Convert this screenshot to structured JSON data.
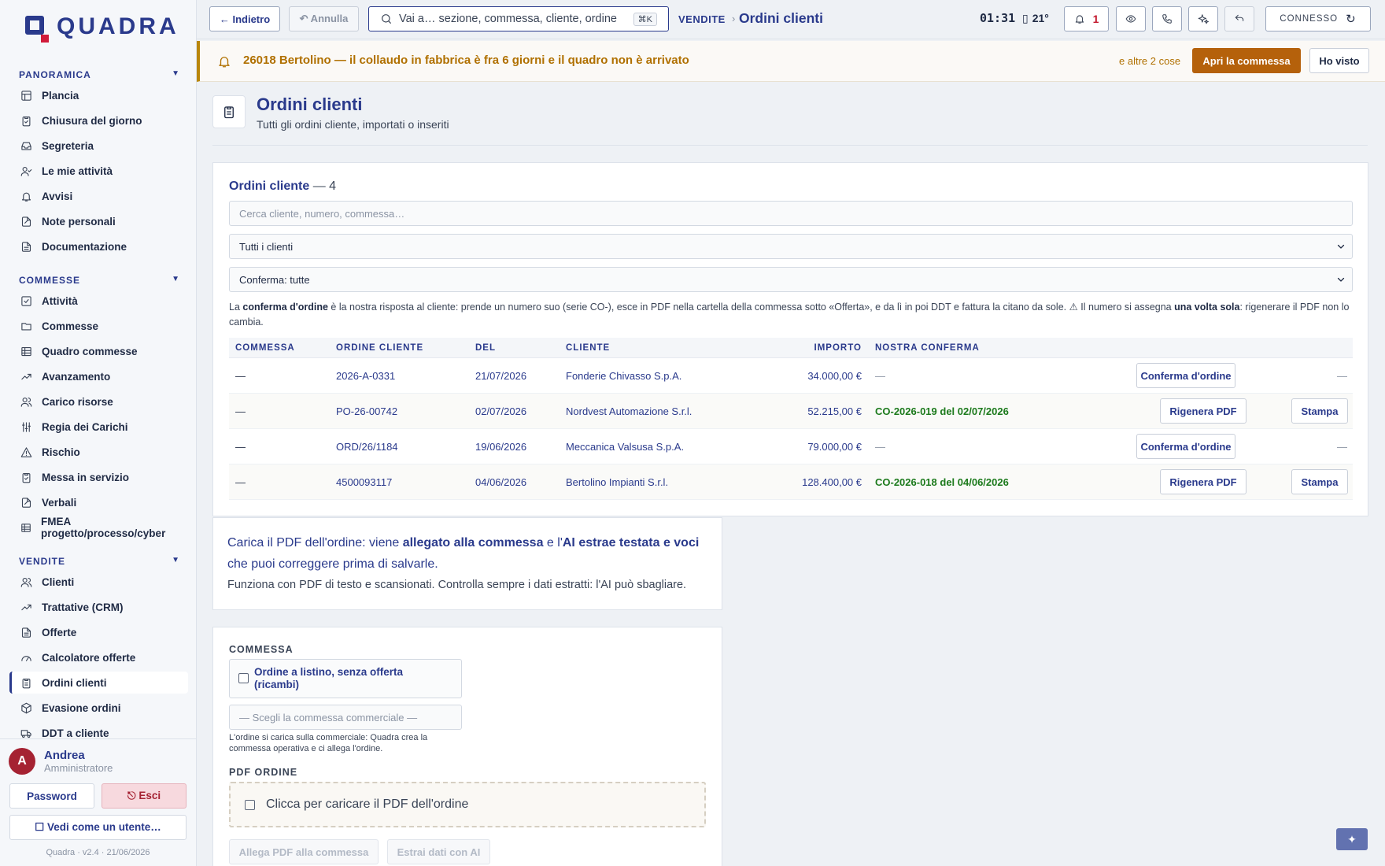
{
  "app": {
    "name": "QUADRA",
    "version": "Quadra · v2.4 · 21/06/2026"
  },
  "sidebar": {
    "sections": [
      {
        "title": "PANORAMICA",
        "items": [
          "Plancia",
          "Chiusura del giorno",
          "Segreteria",
          "Le mie attività",
          "Avvisi",
          "Note personali",
          "Documentazione"
        ]
      },
      {
        "title": "COMMESSE",
        "items": [
          "Attività",
          "Commesse",
          "Quadro commesse",
          "Avanzamento",
          "Carico risorse",
          "Regia dei Carichi",
          "Rischio",
          "Messa in servizio",
          "Verbali",
          "FMEA progetto/processo/cyber"
        ]
      },
      {
        "title": "VENDITE",
        "items": [
          "Clienti",
          "Trattative (CRM)",
          "Offerte",
          "Calcolatore offerte",
          "Ordini clienti",
          "Evasione ordini",
          "DDT a cliente"
        ]
      }
    ],
    "active": "Ordini clienti",
    "user": {
      "initial": "A",
      "name": "Andrea",
      "role": "Amministratore"
    },
    "password_label": "Password",
    "logout_label": "⎋ Esci",
    "impersonate_label": "☐ Vedi come un utente…"
  },
  "topbar": {
    "back_label": "← Indietro",
    "undo_label": "↶ Annulla",
    "search_placeholder": "Vai a… sezione, commessa, cliente, ordine",
    "search_shortcut": "⌘K",
    "breadcrumb_section": "VENDITE",
    "breadcrumb_sep": "›",
    "breadcrumb_page": "Ordini clienti",
    "clock": "01:31",
    "temperature": "21°",
    "notifications": "1",
    "status": "CONNESSO"
  },
  "alert": {
    "text": "26018 Bertolino — il collaudo in fabbrica è fra 6 giorni e il quadro non è arrivato",
    "more": "e altre 2 cose",
    "open_label": "Apri la commessa",
    "seen_label": "Ho visto"
  },
  "page": {
    "title": "Ordini clienti",
    "subtitle": "Tutti gli ordini cliente, importati o inseriti"
  },
  "orders": {
    "title": "Ordini cliente",
    "count": "— 4",
    "search_placeholder": "Cerca cliente, numero, commessa…",
    "client_filter": "Tutti i clienti",
    "confirm_filter": "Conferma: tutte",
    "note": {
      "a": "La ",
      "b": "conferma d'ordine",
      "c": " è la nostra risposta al cliente: prende un numero suo (serie CO-), esce in PDF nella cartella della commessa sotto «Offerta», e da lì in poi DDT e fattura la citano da sole. ⚠ Il numero si assegna ",
      "d": "una volta sola",
      "e": ": rigenerare il PDF non lo cambia."
    },
    "columns": [
      "COMMESSA",
      "ORDINE CLIENTE",
      "DEL",
      "CLIENTE",
      "IMPORTO",
      "NOSTRA CONFERMA"
    ],
    "rows": [
      {
        "commessa": "—",
        "ordine": "2026-A-0331",
        "del": "21/07/2026",
        "cliente": "Fonderie Chivasso S.p.A.",
        "importo": "34.000,00 €",
        "conferma": "—",
        "action": "Conferma d'ordine",
        "print": "—"
      },
      {
        "commessa": "—",
        "ordine": "PO-26-00742",
        "del": "02/07/2026",
        "cliente": "Nordvest Automazione S.r.l.",
        "importo": "52.215,00 €",
        "conferma": "CO-2026-019 del 02/07/2026",
        "action": "Rigenera PDF",
        "print": "Stampa"
      },
      {
        "commessa": "—",
        "ordine": "ORD/26/1184",
        "del": "19/06/2026",
        "cliente": "Meccanica Valsusa S.p.A.",
        "importo": "79.000,00 €",
        "conferma": "—",
        "action": "Conferma d'ordine",
        "print": "—"
      },
      {
        "commessa": "—",
        "ordine": "4500093117",
        "del": "04/06/2026",
        "cliente": "Bertolino Impianti S.r.l.",
        "importo": "128.400,00 €",
        "conferma": "CO-2026-018 del 04/06/2026",
        "action": "Rigenera PDF",
        "print": "Stampa"
      }
    ]
  },
  "upload_info": {
    "a": "Carica il PDF dell'ordine: viene ",
    "b": "allegato alla commessa",
    "c": " e l'",
    "d": "AI estrae testata e voci",
    "e": " che puoi correggere prima di salvarle.",
    "sub": "Funziona con PDF di testo e scansionati. Controlla sempre i dati estratti: l'AI può sbagliare."
  },
  "form": {
    "commessa_label": "COMMESSA",
    "checkbox_label": "Ordine a listino, senza offerta (ricambi)",
    "commessa_placeholder": "— Scegli la commessa commerciale —",
    "commessa_help": "L'ordine si carica sulla commerciale: Quadra crea la commessa operativa e ci allega l'ordine.",
    "pdf_label": "PDF ORDINE",
    "drop_label": "Clicca per caricare il PDF dell'ordine",
    "attach_label": "Allega PDF alla commessa",
    "extract_label": "Estrai dati con AI"
  },
  "fab_label": "✦",
  "colors": {
    "brand": "#2a3a8c",
    "accent_red": "#d11b3a",
    "alert": "#b07000",
    "confirm_green": "#1c7a1c",
    "primary_action": "#b5610b"
  }
}
